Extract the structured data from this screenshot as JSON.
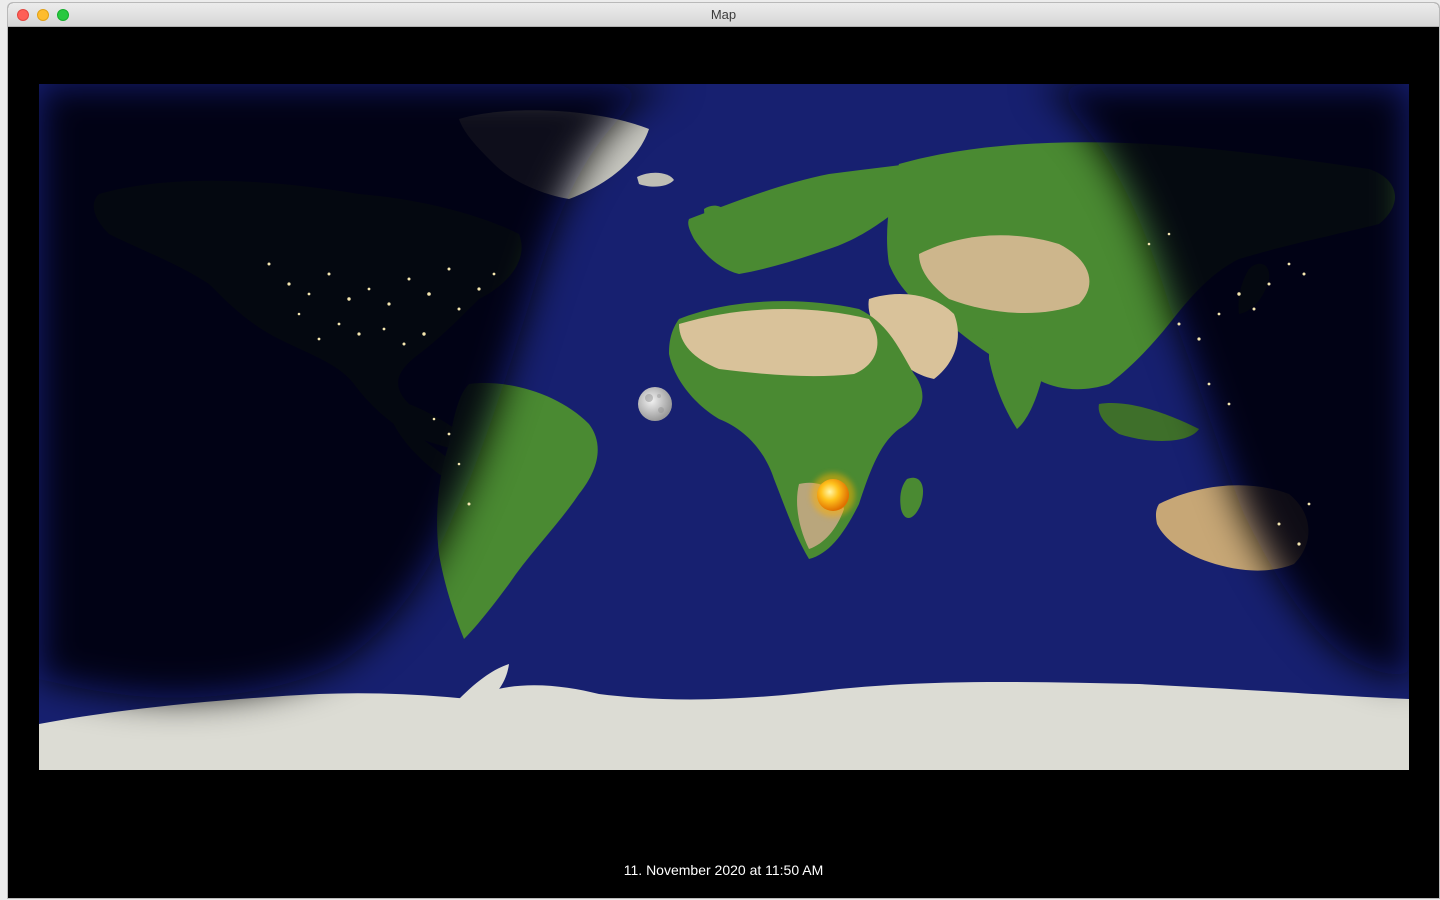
{
  "window": {
    "title": "Map"
  },
  "map": {
    "celestial_markers": [
      {
        "name": "moon-icon"
      },
      {
        "name": "sun-icon"
      }
    ]
  },
  "footer": {
    "date_text": "11. November 2020 at 11:50 AM"
  },
  "colors": {
    "ocean": "#172070",
    "night": "#02040f",
    "land_green": "#3f7a2c",
    "land_desert": "#d9c29a",
    "ice": "#dcdcd4",
    "background": "#000000"
  }
}
